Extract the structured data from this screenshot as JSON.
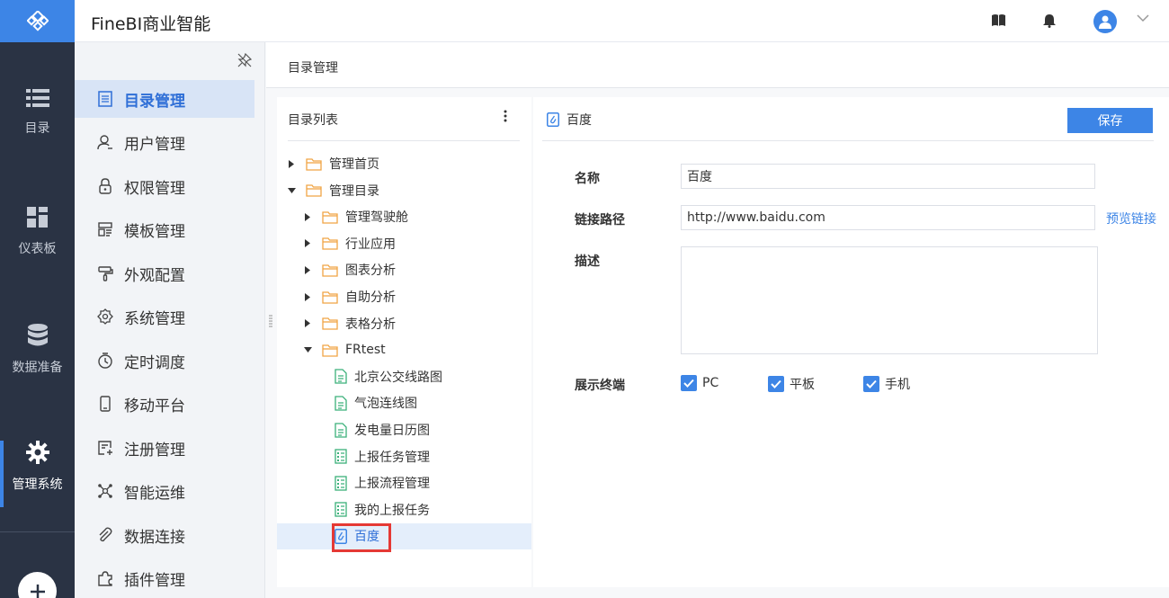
{
  "app": {
    "title": "FineBI商业智能"
  },
  "rail": {
    "items": [
      {
        "label": "目录",
        "icon": "list-icon"
      },
      {
        "label": "仪表板",
        "icon": "dashboard-icon"
      },
      {
        "label": "数据准备",
        "icon": "database-icon"
      },
      {
        "label": "管理系统",
        "icon": "gear-icon",
        "active": true
      }
    ]
  },
  "menu": {
    "items": [
      {
        "label": "目录管理",
        "icon": "catalog-icon",
        "active": true
      },
      {
        "label": "用户管理",
        "icon": "user-icon"
      },
      {
        "label": "权限管理",
        "icon": "lock-icon"
      },
      {
        "label": "模板管理",
        "icon": "template-icon"
      },
      {
        "label": "外观配置",
        "icon": "brush-icon"
      },
      {
        "label": "系统管理",
        "icon": "settings-icon"
      },
      {
        "label": "定时调度",
        "icon": "timer-icon"
      },
      {
        "label": "移动平台",
        "icon": "mobile-icon"
      },
      {
        "label": "注册管理",
        "icon": "register-icon"
      },
      {
        "label": "智能运维",
        "icon": "network-icon"
      },
      {
        "label": "数据连接",
        "icon": "paperclip-icon"
      },
      {
        "label": "插件管理",
        "icon": "plugin-icon"
      }
    ]
  },
  "breadcrumb": "目录管理",
  "tree": {
    "header": "目录列表",
    "nodes": [
      {
        "label": "管理首页",
        "type": "folder",
        "level": 0,
        "expanded": false
      },
      {
        "label": "管理目录",
        "type": "folder",
        "level": 0,
        "expanded": true
      },
      {
        "label": "管理驾驶舱",
        "type": "folder",
        "level": 1,
        "expanded": false
      },
      {
        "label": "行业应用",
        "type": "folder",
        "level": 1,
        "expanded": false
      },
      {
        "label": "图表分析",
        "type": "folder",
        "level": 1,
        "expanded": false
      },
      {
        "label": "自助分析",
        "type": "folder",
        "level": 1,
        "expanded": false
      },
      {
        "label": "表格分析",
        "type": "folder",
        "level": 1,
        "expanded": false
      },
      {
        "label": "FRtest",
        "type": "folder",
        "level": 1,
        "expanded": true
      },
      {
        "label": "北京公交线路图",
        "type": "report",
        "level": 2
      },
      {
        "label": "气泡连线图",
        "type": "report",
        "level": 2
      },
      {
        "label": "发电量日历图",
        "type": "report",
        "level": 2
      },
      {
        "label": "上报任务管理",
        "type": "form",
        "level": 2
      },
      {
        "label": "上报流程管理",
        "type": "form",
        "level": 2
      },
      {
        "label": "我的上报任务",
        "type": "form",
        "level": 2
      },
      {
        "label": "百度",
        "type": "link",
        "level": 2,
        "selected": true
      }
    ]
  },
  "detail": {
    "title": "百度",
    "save_label": "保存",
    "name_label": "名称",
    "name_value": "百度",
    "path_label": "链接路径",
    "path_value": "http://www.baidu.com",
    "preview_label": "预览链接",
    "desc_label": "描述",
    "desc_value": "",
    "terminal_label": "展示终端",
    "terminals": [
      {
        "label": "PC",
        "checked": true
      },
      {
        "label": "平板",
        "checked": true
      },
      {
        "label": "手机",
        "checked": true
      }
    ]
  },
  "colors": {
    "accent": "#3d85e6",
    "rail_bg": "#2a3344",
    "folder": "#f0a545",
    "report": "#3bb07a",
    "highlight": "#e53935"
  }
}
